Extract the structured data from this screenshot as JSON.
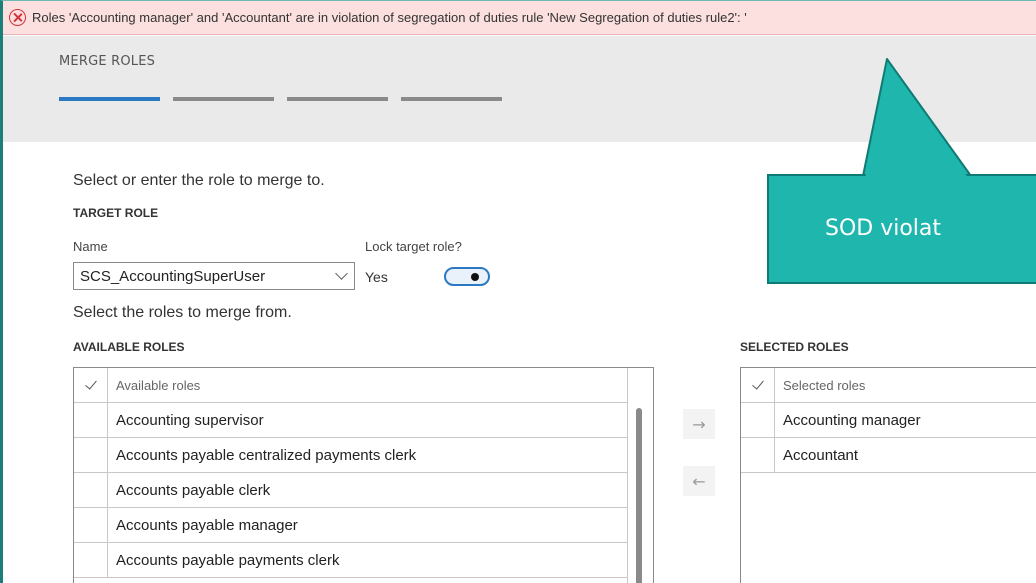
{
  "error_banner": {
    "message": "Roles 'Accounting manager' and 'Accountant' are in violation of segregation of duties rule 'New Segregation of duties rule2': '"
  },
  "dialog": {
    "title": "MERGE ROLES",
    "steps_total": 4,
    "active_step": 1
  },
  "target": {
    "instruction": "Select or enter the role to merge to.",
    "section_label": "TARGET ROLE",
    "name_label": "Name",
    "name_value": "SCS_AccountingSuperUser",
    "lock_label": "Lock target role?",
    "lock_value": "Yes",
    "lock_on": true
  },
  "merge_from": {
    "instruction": "Select the roles to merge from."
  },
  "available_roles": {
    "section_label": "AVAILABLE ROLES",
    "column_header": "Available roles",
    "rows": [
      "Accounting supervisor",
      "Accounts payable centralized payments clerk",
      "Accounts payable clerk",
      "Accounts payable manager",
      "Accounts payable payments clerk"
    ]
  },
  "selected_roles": {
    "section_label": "SELECTED ROLES",
    "column_header": "Selected roles",
    "rows": [
      "Accounting manager",
      "Accountant"
    ]
  },
  "buttons": {
    "add_arrow": "→",
    "remove_arrow": "←"
  },
  "callout": {
    "text": "SOD violat",
    "color": "#1fb7ad"
  },
  "colors": {
    "banner_bg": "#fcdfdf",
    "error_red": "#d13438",
    "accent_blue": "#2b79c2"
  }
}
